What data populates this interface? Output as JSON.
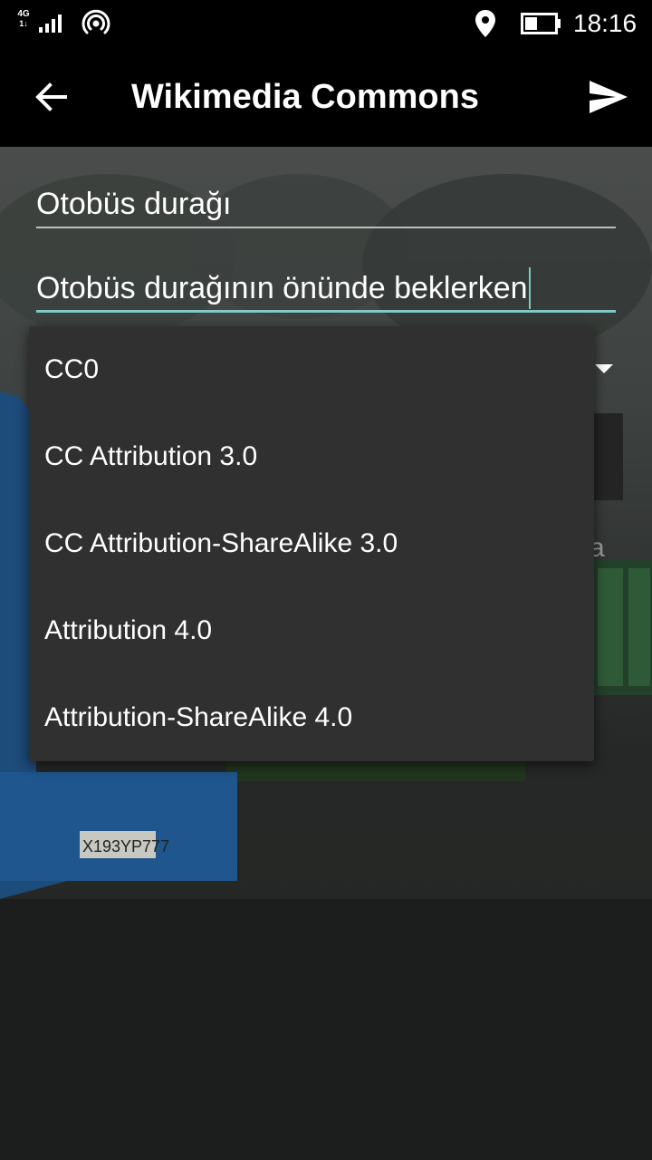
{
  "status_bar": {
    "network_type_top": "4G",
    "network_type_bottom": "1↓",
    "signal_icon": "cell-signal-icon",
    "hotspot_icon": "hotspot-icon",
    "location_icon": "location-pin-icon",
    "battery_icon": "battery-icon",
    "time": "18:16"
  },
  "toolbar": {
    "back_icon": "arrow-back-icon",
    "title": "Wikimedia Commons",
    "send_icon": "send-icon"
  },
  "form": {
    "title_value": "Otobüs durağı",
    "description_value": "Otobüs durağının önünde beklerken",
    "license_spinner_icon": "dropdown-arrow-icon",
    "partial_label": "a"
  },
  "license_dropdown": {
    "options": [
      "CC0",
      "CC Attribution 3.0",
      "CC Attribution-ShareAlike 3.0",
      "Attribution 4.0",
      "Attribution-ShareAlike 4.0"
    ]
  },
  "background_photo": {
    "license_plate": "X193YP777"
  },
  "colors": {
    "toolbar_bg": "#000000",
    "accent": "#7fcbc4",
    "dropdown_bg": "#303030",
    "text": "#ffffff"
  }
}
